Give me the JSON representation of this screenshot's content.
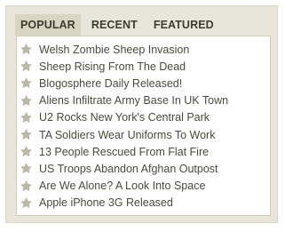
{
  "tabs": [
    {
      "label": "POPULAR",
      "active": true
    },
    {
      "label": "RECENT",
      "active": false
    },
    {
      "label": "FEATURED",
      "active": false
    }
  ],
  "items": [
    {
      "title": "Welsh Zombie Sheep Invasion"
    },
    {
      "title": "Sheep Rising From The Dead"
    },
    {
      "title": "Blogosphere Daily Released!"
    },
    {
      "title": "Aliens Infiltrate Army Base In UK Town"
    },
    {
      "title": "U2 Rocks New York's Central Park"
    },
    {
      "title": "TA Soldiers Wear Uniforms To Work"
    },
    {
      "title": "13 People Rescued From Flat Fire"
    },
    {
      "title": "US Troops Abandon Afghan Outpost"
    },
    {
      "title": "Are We Alone? A Look Into Space"
    },
    {
      "title": "Apple iPhone 3G Released"
    }
  ],
  "colors": {
    "widget_bg": "#e8e6db",
    "active_tab_bg": "#d9d5c3",
    "star": "#bdb9a8",
    "text": "#4a4a40"
  },
  "icons": {
    "item_icon": "star-icon"
  }
}
